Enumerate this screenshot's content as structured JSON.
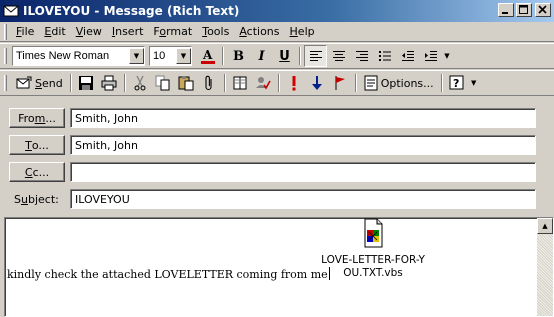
{
  "window": {
    "title": "ILOVEYOU - Message (Rich Text)",
    "minimize_glyph": "_",
    "maximize_glyph": "□",
    "close_glyph": "×"
  },
  "menu": [
    {
      "key": "F",
      "rest": "ile"
    },
    {
      "key": "E",
      "rest": "dit"
    },
    {
      "key": "V",
      "rest": "iew"
    },
    {
      "key": "I",
      "rest": "nsert"
    },
    {
      "key": "",
      "pre": "F",
      "key2": "o",
      "rest": "rmat"
    },
    {
      "key": "T",
      "rest": "ools"
    },
    {
      "key": "A",
      "rest": "ctions"
    },
    {
      "key": "H",
      "rest": "elp"
    }
  ],
  "format_toolbar": {
    "font_name": "Times New Roman",
    "font_size": "10",
    "bold": "B",
    "italic": "I",
    "underline": "U"
  },
  "standard_toolbar": {
    "send_label_key": "S",
    "send_label_rest": "end",
    "options_label_pre": "Options...",
    "help_glyph": "?"
  },
  "fields": {
    "from": {
      "button_key": "m",
      "button_pre": "Fro",
      "button_post": "...",
      "value": "Smith, John"
    },
    "to": {
      "button_key": "T",
      "button_pre": "",
      "button_post": "o...",
      "value": "Smith, John"
    },
    "cc": {
      "button_key": "C",
      "button_pre": "",
      "button_post": "c...",
      "value": ""
    },
    "subject": {
      "label_pre": "S",
      "label_key": "u",
      "label_post": "bject:",
      "value": "ILOVEYOU"
    }
  },
  "body": {
    "text": "kindly check the attached LOVELETTER coming from me",
    "attachment_line1": "LOVE-LETTER-FOR-Y",
    "attachment_line2": "OU.TXT.vbs"
  },
  "colors": {
    "face": "#d4d0c8",
    "title_start": "#0a246a",
    "title_end": "#a6caf0",
    "font_color_bar": "#cc0000",
    "importance_red": "#d00000",
    "importance_blue": "#00208c"
  }
}
